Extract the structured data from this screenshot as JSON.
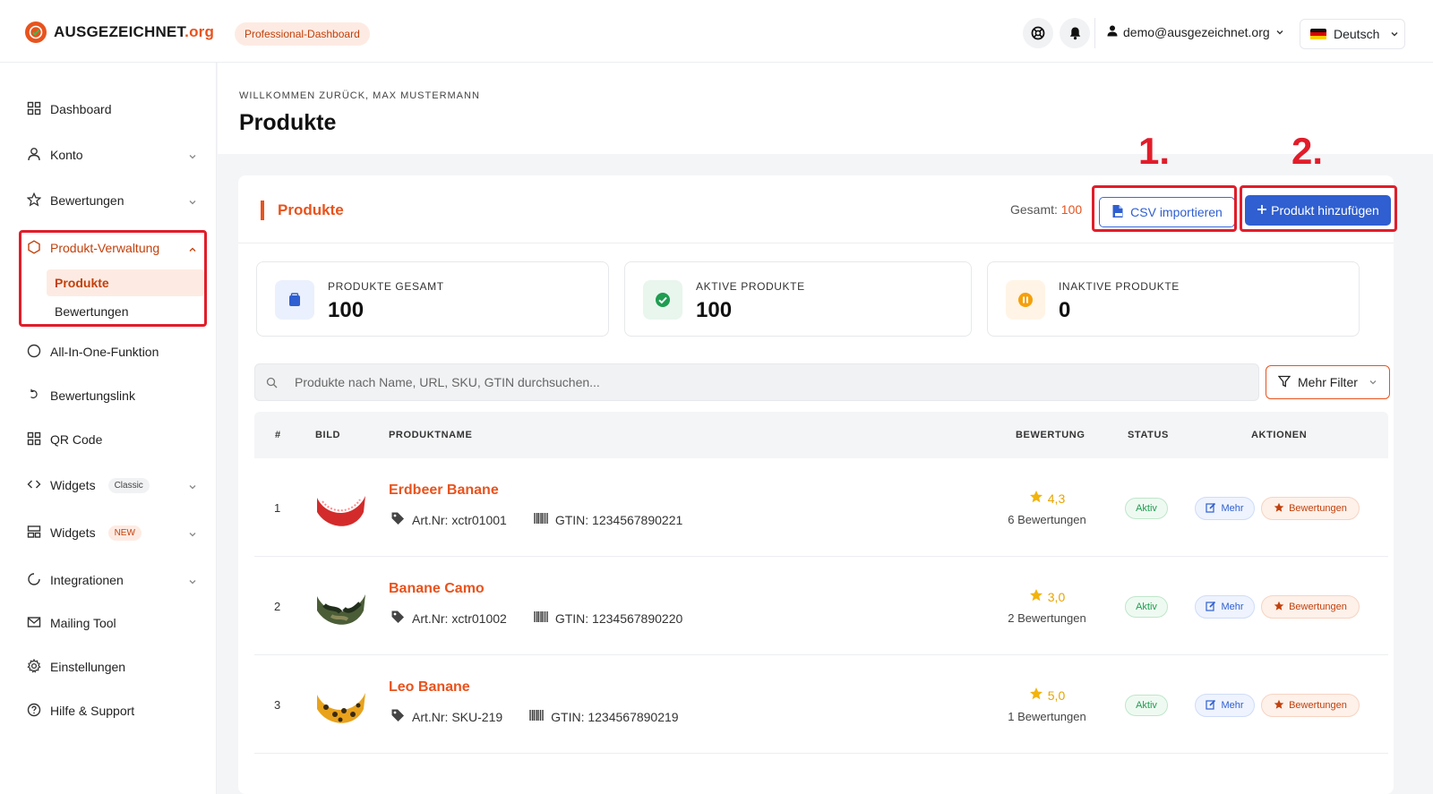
{
  "header": {
    "logo_main": "AUSGEZEICHNET",
    "logo_suffix": ".org",
    "plan_badge": "Professional-Dashboard",
    "user_email": "demo@ausgezeichnet.org",
    "language": "Deutsch"
  },
  "sidebar": {
    "dashboard": "Dashboard",
    "konto": "Konto",
    "bewertungen": "Bewertungen",
    "produkt_verwaltung": "Produkt-Verwaltung",
    "sub_produkte": "Produkte",
    "sub_bewertungen": "Bewertungen",
    "all_in_one": "All-In-One-Funktion",
    "bewertungslink": "Bewertungslink",
    "qr_code": "QR Code",
    "widgets_classic": "Widgets",
    "badge_classic": "Classic",
    "widgets_new": "Widgets",
    "badge_new": "NEW",
    "integrationen": "Integrationen",
    "mailing_tool": "Mailing Tool",
    "einstellungen": "Einstellungen",
    "hilfe": "Hilfe & Support"
  },
  "page": {
    "welcome": "WILLKOMMEN ZURÜCK, MAX MUSTERMANN",
    "title": "Produkte",
    "annotation_1": "1.",
    "annotation_2": "2."
  },
  "card": {
    "title": "Produkte",
    "total_label": "Gesamt:",
    "total_value": "100",
    "csv_button": "CSV importieren",
    "add_button": "Produkt hinzufügen"
  },
  "stats": {
    "total_label": "PRODUKTE GESAMT",
    "total_value": "100",
    "active_label": "AKTIVE PRODUKTE",
    "active_value": "100",
    "inactive_label": "INAKTIVE PRODUKTE",
    "inactive_value": "0"
  },
  "search": {
    "placeholder": "Produkte nach Name, URL, SKU, GTIN durchsuchen...",
    "filter_label": "Mehr Filter"
  },
  "table": {
    "headers": [
      "#",
      "BILD",
      "PRODUKTNAME",
      "BEWERTUNG",
      "STATUS",
      "AKTIONEN"
    ],
    "rows": [
      {
        "index": "1",
        "name": "Erdbeer Banane",
        "sku": "Art.Nr: xctr01001",
        "gtin": "GTIN: 1234567890221",
        "score": "4,3",
        "reviews": "6 Bewertungen",
        "status": "Aktiv",
        "more": "Mehr",
        "rev_btn": "Bewertungen"
      },
      {
        "index": "2",
        "name": "Banane Camo",
        "sku": "Art.Nr: xctr01002",
        "gtin": "GTIN: 1234567890220",
        "score": "3,0",
        "reviews": "2 Bewertungen",
        "status": "Aktiv",
        "more": "Mehr",
        "rev_btn": "Bewertungen"
      },
      {
        "index": "3",
        "name": "Leo Banane",
        "sku": "Art.Nr: SKU-219",
        "gtin": "GTIN: 1234567890219",
        "score": "5,0",
        "reviews": "1 Bewertungen",
        "status": "Aktiv",
        "more": "Mehr",
        "rev_btn": "Bewertungen"
      }
    ]
  },
  "colors": {
    "brand_orange": "#e8531d",
    "primary_blue": "#2f5fd0",
    "annotation_red": "#e11d2a",
    "active_green": "#1f9d50"
  }
}
